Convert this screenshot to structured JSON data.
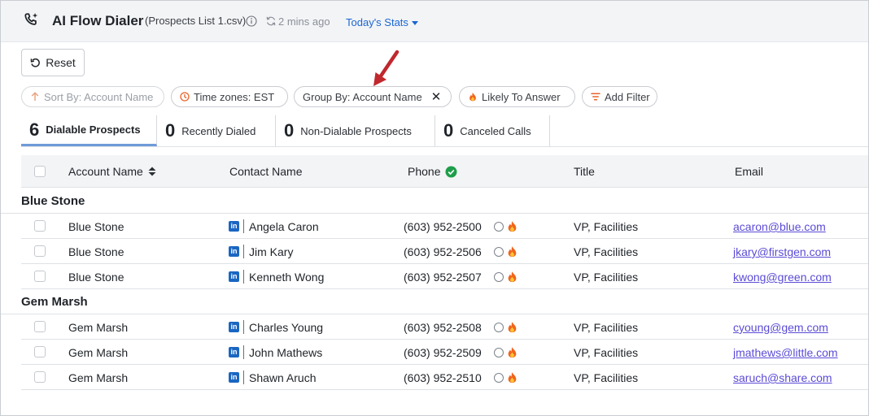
{
  "header": {
    "app_title": "AI Flow Dialer",
    "list_name": "(Prospects List 1.csv)",
    "updated": "2 mins ago",
    "stats_label": "Today's Stats"
  },
  "toolbar": {
    "reset_label": "Reset"
  },
  "filters": [
    {
      "label": "Sort By: Account Name",
      "state": "disabled"
    },
    {
      "label": "Time zones: EST"
    },
    {
      "label": "Group By: Account Name",
      "removable": true
    },
    {
      "label": "Likely To Answer"
    },
    {
      "label": "Add Filter"
    }
  ],
  "tabs": [
    {
      "count": "6",
      "label": "Dialable Prospects",
      "active": true
    },
    {
      "count": "0",
      "label": "Recently Dialed"
    },
    {
      "count": "0",
      "label": "Non-Dialable Prospects"
    },
    {
      "count": "0",
      "label": "Canceled Calls"
    }
  ],
  "table": {
    "columns": [
      "Account Name",
      "Contact Name",
      "Phone",
      "Title",
      "Email"
    ],
    "groups": [
      {
        "name": "Blue Stone",
        "rows": [
          {
            "account": "Blue Stone",
            "contact": "Angela Caron",
            "phone": "(603) 952-2500",
            "title": "VP, Facilities",
            "email": "acaron@blue.com"
          },
          {
            "account": "Blue Stone",
            "contact": "Jim Kary",
            "phone": "(603) 952-2506",
            "title": "VP, Facilities",
            "email": "jkary@firstgen.com"
          },
          {
            "account": "Blue Stone",
            "contact": "Kenneth Wong",
            "phone": "(603) 952-2507",
            "title": "VP, Facilities",
            "email": "kwong@green.com"
          }
        ]
      },
      {
        "name": "Gem Marsh",
        "rows": [
          {
            "account": "Gem Marsh",
            "contact": "Charles Young",
            "phone": "(603) 952-2508",
            "title": "VP, Facilities",
            "email": "cyoung@gem.com"
          },
          {
            "account": "Gem Marsh",
            "contact": "John Mathews",
            "phone": "(603) 952-2509",
            "title": "VP, Facilities",
            "email": "jmathews@little.com"
          },
          {
            "account": "Gem Marsh",
            "contact": "Shawn Aruch",
            "phone": "(603) 952-2510",
            "title": "VP, Facilities",
            "email": "saruch@share.com"
          }
        ]
      }
    ]
  },
  "icons": {
    "app": "phone-sparkle-icon",
    "info": "info-icon",
    "refresh": "refresh-icon",
    "reset": "undo-icon",
    "sort": "arrow-up-icon",
    "timezone": "clock-icon",
    "remove": "close-icon",
    "likely": "fire-icon",
    "filter": "filter-icon",
    "sort_column": "sort-icon",
    "phone_verified": "check-circle-icon",
    "linkedin": "linkedin-icon",
    "status": "circle-icon",
    "hot": "fire-icon",
    "annotation": "red-arrow-icon"
  },
  "colors": {
    "accent": "#1a66d2",
    "orange": "#e8642c",
    "green": "#1e9e4a",
    "linkedin": "#1a66c2",
    "email_link": "#5a4bd6",
    "annotation": "#c0282d",
    "active_tab": "#6f9ad8"
  }
}
